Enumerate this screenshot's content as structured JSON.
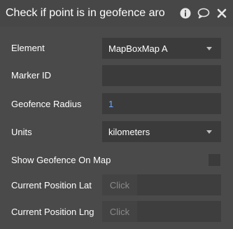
{
  "header": {
    "title": "Check if point is in geofence aro",
    "icons": [
      "info-icon",
      "comment-icon",
      "close-icon"
    ]
  },
  "fields": {
    "element": {
      "label": "Element",
      "value": "MapBoxMap A"
    },
    "marker_id": {
      "label": "Marker ID",
      "value": ""
    },
    "geofence_radius": {
      "label": "Geofence Radius",
      "value": "1"
    },
    "units": {
      "label": "Units",
      "value": "kilometers"
    },
    "show_geofence": {
      "label": "Show Geofence On Map",
      "checked": false
    },
    "current_lat": {
      "label": "Current Position Lat",
      "button": "Click"
    },
    "current_lng": {
      "label": "Current Position Lng",
      "button": "Click"
    }
  },
  "colors": {
    "panel_bg": "#4a4a4a",
    "control_bg": "#3b3b3b",
    "number_value": "#6ea7ff"
  }
}
